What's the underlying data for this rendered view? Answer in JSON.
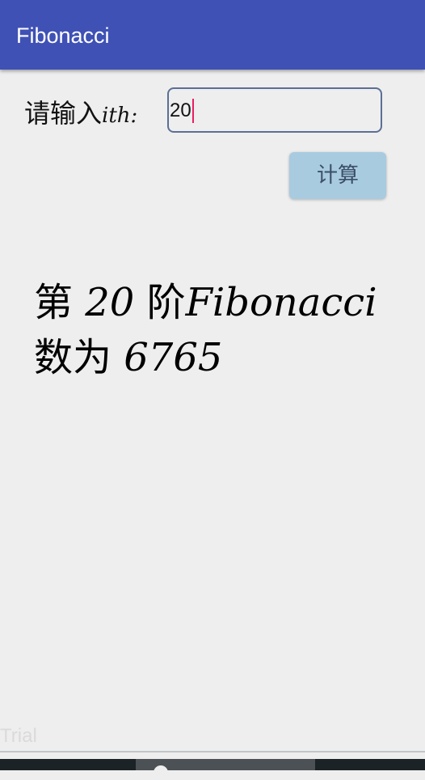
{
  "app_bar": {
    "title": "Fibonacci",
    "color": "#3f51b5"
  },
  "input": {
    "label_prefix": "请输入",
    "label_suffix": "ith:",
    "value": "20"
  },
  "button": {
    "label": "计算",
    "color": "#a8cbe0"
  },
  "result": {
    "prefix": "第 ",
    "n": "20",
    "middle": " 阶",
    "word": "Fibonacci",
    "suffix": "数为 ",
    "value": "6765"
  },
  "watermark": "Trial",
  "colors": {
    "background": "#eeeeee",
    "caret": "#e91e63"
  }
}
